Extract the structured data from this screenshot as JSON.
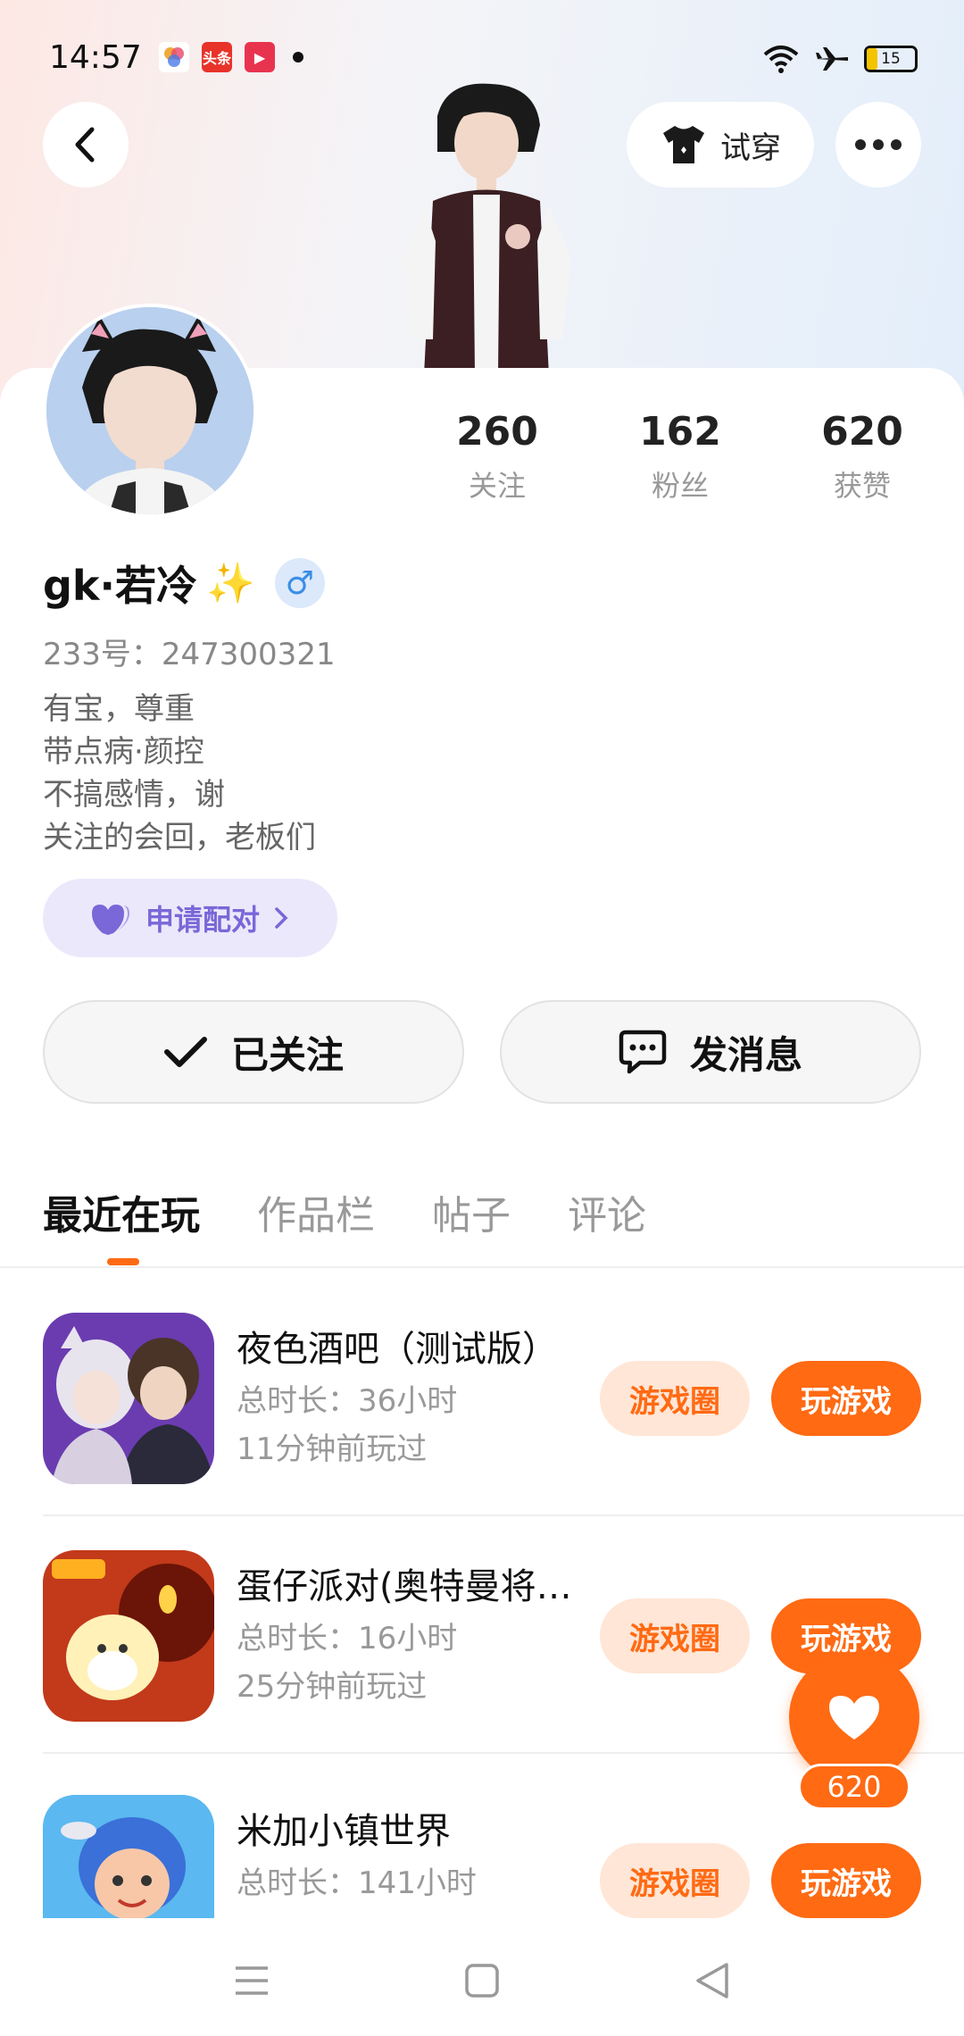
{
  "status_bar": {
    "time": "14:57",
    "apps": [
      {
        "icon": "photos-app-icon",
        "text": "",
        "color": "#ffffff"
      },
      {
        "icon": "toutiao-app-icon",
        "text": "头条",
        "color": "#e8332a"
      },
      {
        "icon": "video-app-icon",
        "text": "▶",
        "color": "#e8334f"
      }
    ],
    "battery_level": "15",
    "icons": [
      "wifi-icon",
      "airplane-mode-icon",
      "battery-icon"
    ]
  },
  "header": {
    "try_on_label": "试穿"
  },
  "profile": {
    "stats": [
      {
        "value": "260",
        "label": "关注"
      },
      {
        "value": "162",
        "label": "粉丝"
      },
      {
        "value": "620",
        "label": "获赞"
      }
    ],
    "name": "gk·若冷",
    "sparkle": "✨",
    "gender_symbol": "♂",
    "uid": "233号：247300321",
    "bio": [
      "有宝，尊重",
      "带点病·颜控",
      "不搞感情，谢",
      "关注的会回，老板们"
    ],
    "pair_label": "申请配对"
  },
  "actions": {
    "followed_label": "已关注",
    "message_label": "发消息"
  },
  "tabs": [
    "最近在玩",
    "作品栏",
    "帖子",
    "评论"
  ],
  "games": [
    {
      "title": "夜色酒吧（测试版）",
      "duration": "总时长：36小时",
      "last_played": "11分钟前玩过",
      "circle_label": "游戏圈",
      "play_label": "玩游戏"
    },
    {
      "title": "蛋仔派对(奥特曼将…",
      "duration": "总时长：16小时",
      "last_played": "25分钟前玩过",
      "circle_label": "游戏圈",
      "play_label": "玩游戏"
    },
    {
      "title": "米加小镇世界",
      "duration": "总时长：141小时",
      "last_played": "",
      "circle_label": "游戏圈",
      "play_label": "玩游戏"
    }
  ],
  "like_fab": {
    "count": "620"
  },
  "colors": {
    "accent": "#ff6a13",
    "pair_purple": "#7a67d8",
    "gender_blue": "#3a8ee6"
  }
}
